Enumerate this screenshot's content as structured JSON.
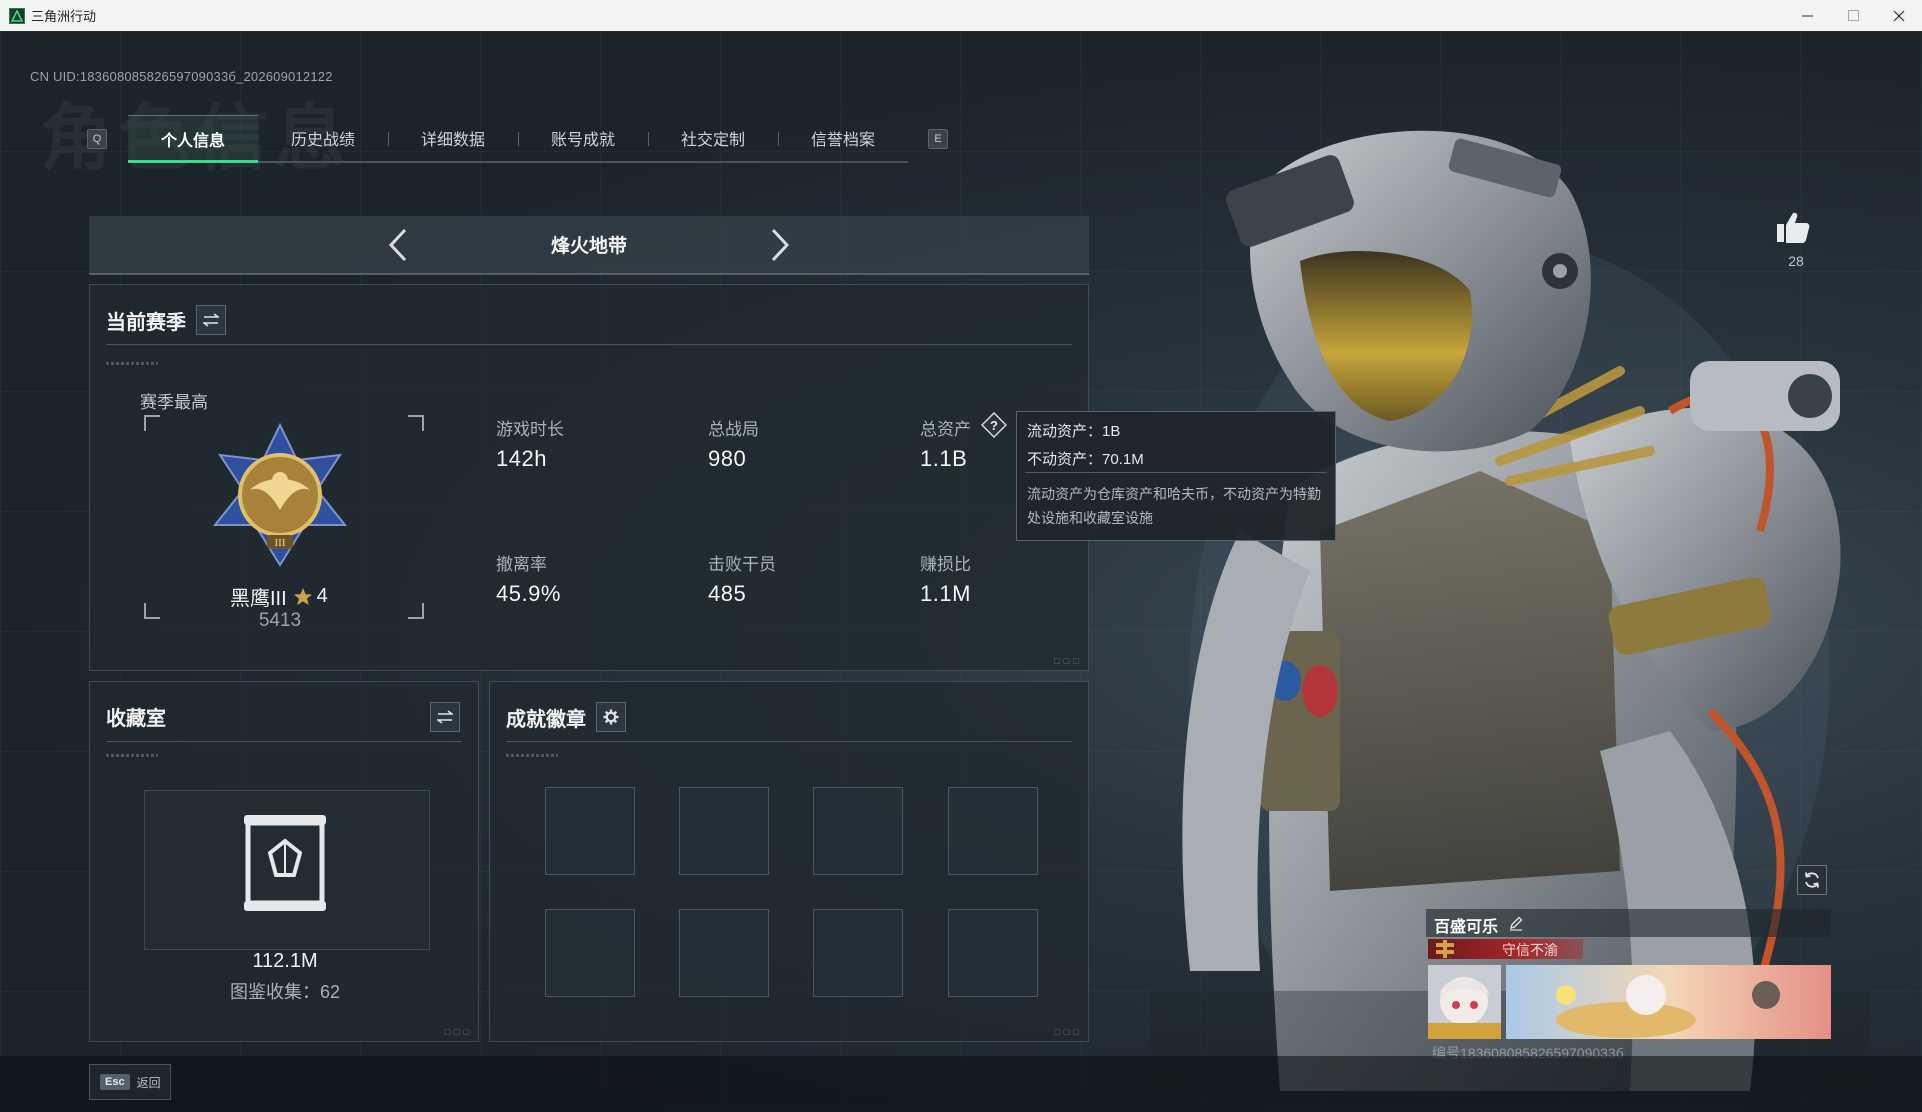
{
  "window": {
    "title": "三角洲行动",
    "controls": [
      "minimize",
      "maximize",
      "close"
    ]
  },
  "header": {
    "uid": "CN UID:18360808582659709033б_202609012122",
    "key_left": "Q",
    "key_right": "E",
    "tabs": [
      {
        "label": "个人信息",
        "active": true
      },
      {
        "label": "历史战绩",
        "active": false
      },
      {
        "label": "详细数据",
        "active": false
      },
      {
        "label": "账号成就",
        "active": false
      },
      {
        "label": "社交定制",
        "active": false
      },
      {
        "label": "信誉档案",
        "active": false
      }
    ]
  },
  "mode_selector": {
    "label": "烽火地带"
  },
  "season": {
    "title": "当前赛季",
    "best_label": "赛季最高",
    "rank_name": "黑鹰III",
    "rank_stars": "4",
    "rank_points": "5413",
    "stats": [
      {
        "label": "游戏时长",
        "value": "142h"
      },
      {
        "label": "总战局",
        "value": "980"
      },
      {
        "label": "总资产",
        "value": "1.1B"
      },
      {
        "label": "撤离率",
        "value": "45.9%"
      },
      {
        "label": "击败干员",
        "value": "485"
      },
      {
        "label": "赚损比",
        "value": "1.1M"
      }
    ]
  },
  "tooltip": {
    "liquid": "流动资产：1B",
    "fixed": "不动资产：70.1M",
    "description": "流动资产为仓库资产和哈夫币，不动资产为特勤处设施和收藏室设施"
  },
  "collection": {
    "title": "收藏室",
    "value": "112.1M",
    "catalog": "图鉴收集：62"
  },
  "achievements": {
    "title": "成就徽章",
    "slot_count": 8
  },
  "profile": {
    "likes": "28",
    "player_name": "百盛可乐",
    "motto": "守信不渝",
    "card_id": "编号18360808582659709033б"
  },
  "footer": {
    "esc_key": "Esc",
    "esc_label": "返回"
  },
  "colors": {
    "accent": "#2fe08f",
    "panel_bg": "#202930",
    "motto_red": "#a8262a"
  }
}
